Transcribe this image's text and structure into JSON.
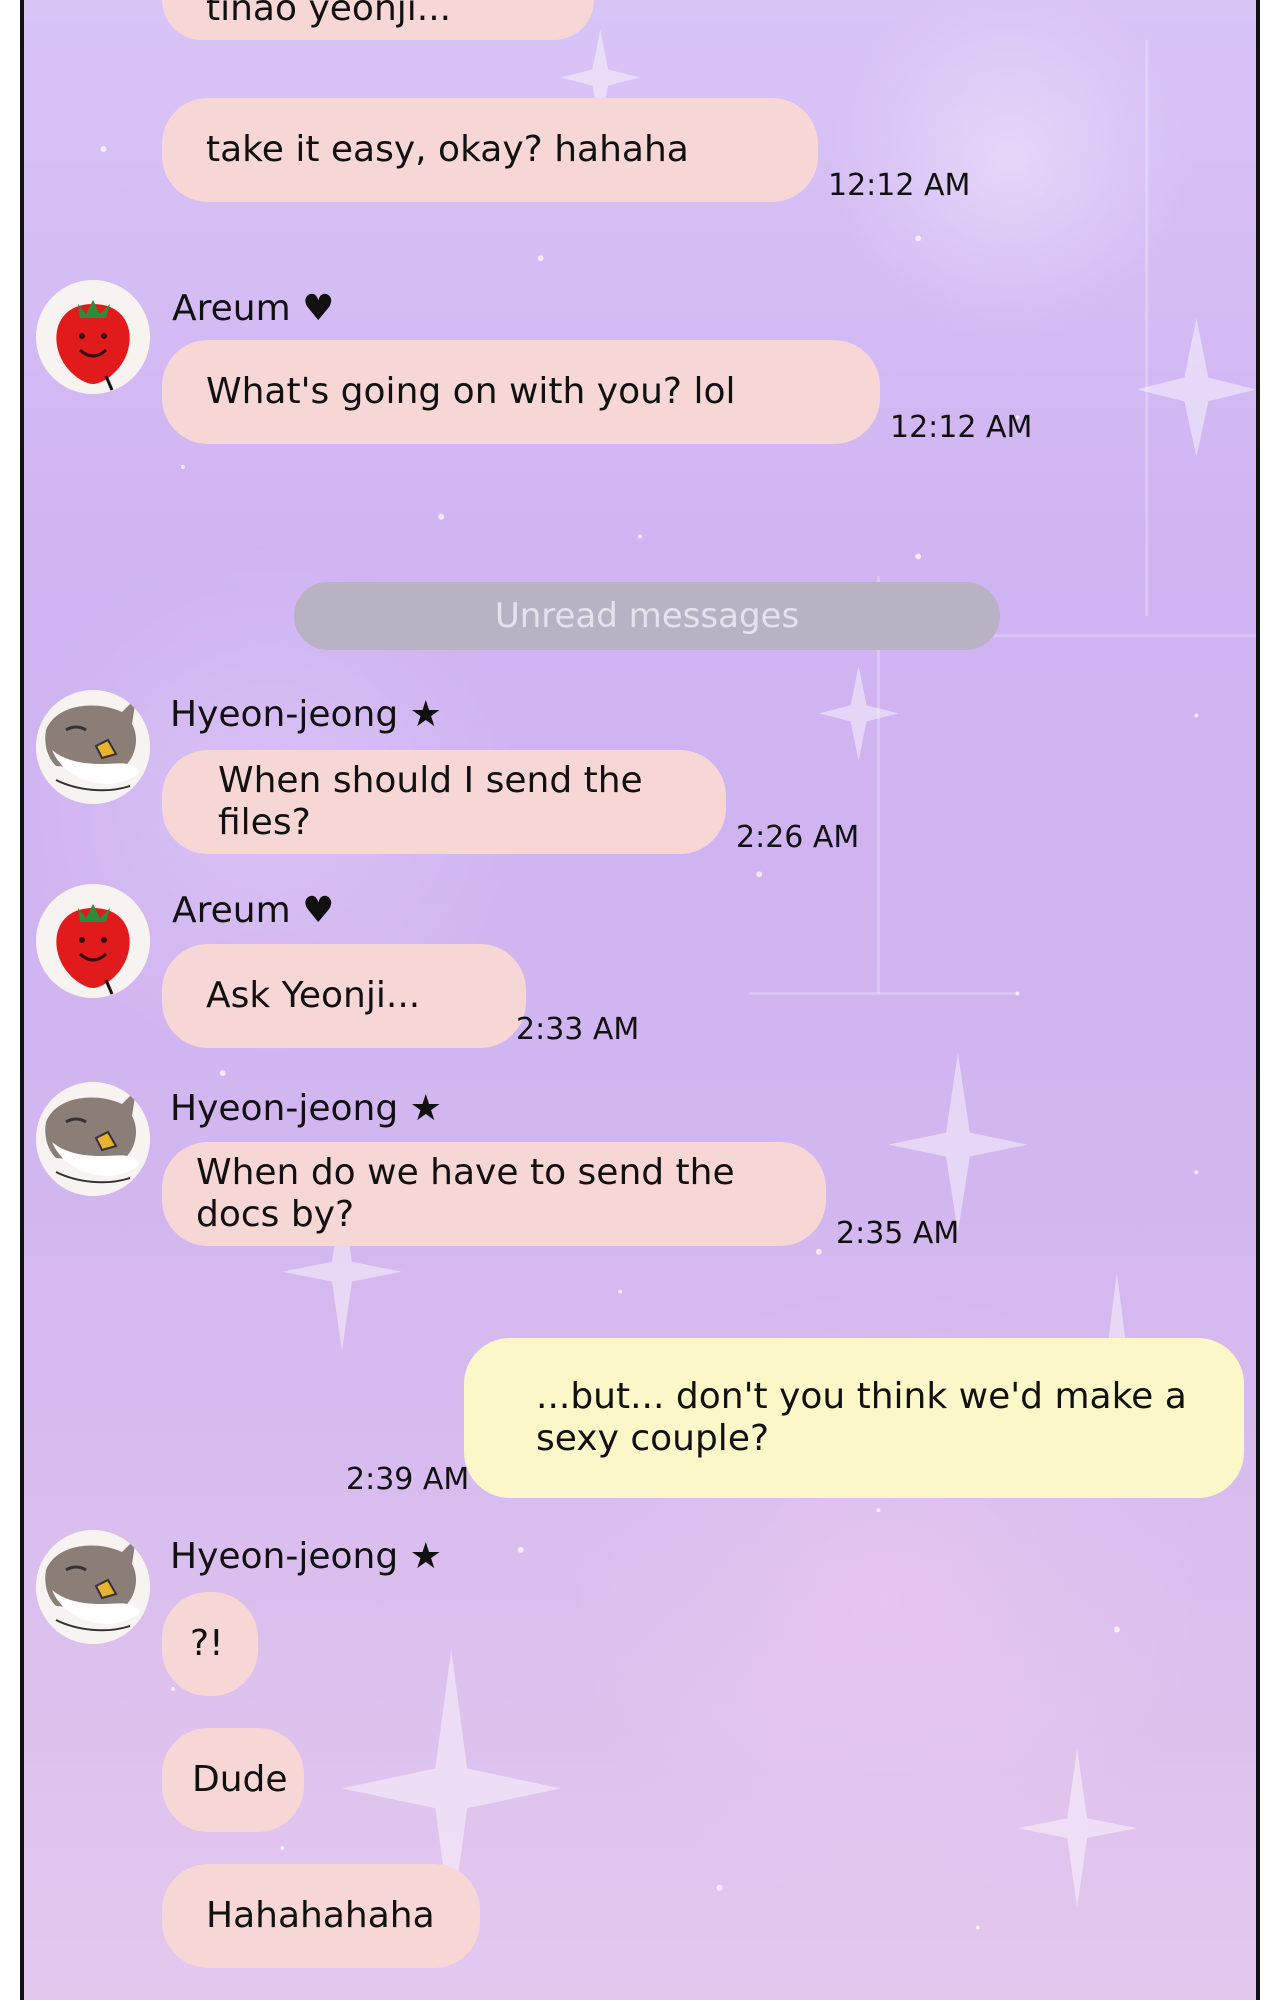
{
  "chat": {
    "messages": [
      {
        "id": "m0",
        "sender": "",
        "text": "tinao yeonji...",
        "time": ""
      },
      {
        "id": "m1",
        "sender": "",
        "text": "take it easy, okay? hahaha",
        "time": "12:12 AM"
      },
      {
        "id": "m2",
        "sender": "Areum ♥",
        "avatar_icon": "strawberry-icon",
        "text": "What's going on with you? lol",
        "time": "12:12 AM"
      },
      {
        "id": "m3",
        "sender": "Hyeon-jeong ★",
        "avatar_icon": "cat-icon",
        "text": "When should I send the files?",
        "time": "2:26 AM"
      },
      {
        "id": "m4",
        "sender": "Areum ♥",
        "avatar_icon": "strawberry-icon",
        "text": "Ask Yeonji...",
        "time": "2:33 AM"
      },
      {
        "id": "m5",
        "sender": "Hyeon-jeong ★",
        "avatar_icon": "cat-icon",
        "text": "When do we have to send the docs by?",
        "time": "2:35 AM"
      },
      {
        "id": "m6",
        "sender": "me",
        "text": "...but... don't you think we'd make a sexy couple?",
        "time": "2:39 AM"
      },
      {
        "id": "m7",
        "sender": "Hyeon-jeong ★",
        "avatar_icon": "cat-icon",
        "text": "?!",
        "time": ""
      },
      {
        "id": "m8",
        "sender": "Hyeon-jeong ★",
        "text": "Dude",
        "time": ""
      },
      {
        "id": "m9",
        "sender": "Hyeon-jeong ★",
        "text": "Hahahahaha",
        "time": ""
      }
    ],
    "unread_label": "Unread messages"
  },
  "colors": {
    "background": "#d2b6ef",
    "incoming_bubble": "#f7d6d6",
    "outgoing_bubble": "#fbf7c9",
    "unread_pill": "#b9b1c4"
  }
}
